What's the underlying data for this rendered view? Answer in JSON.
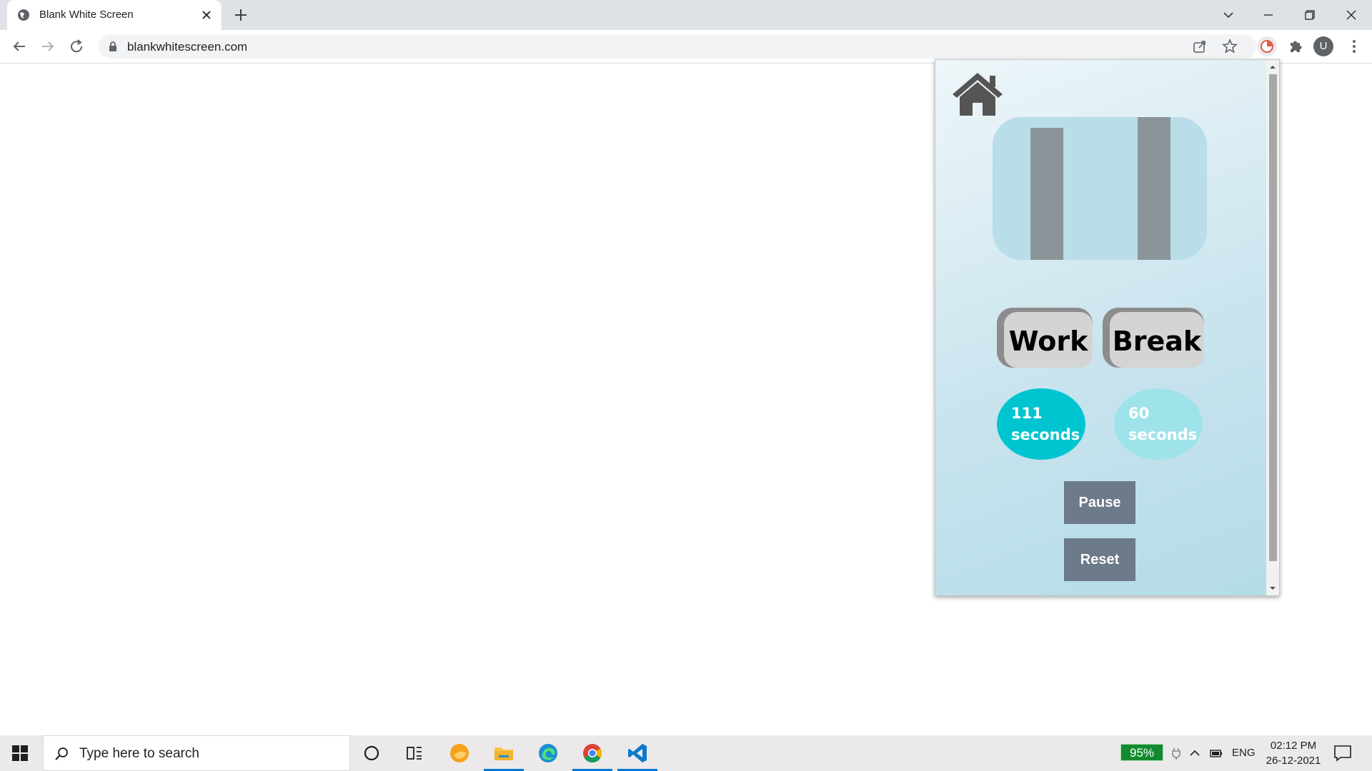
{
  "browser": {
    "tab_title": "Blank White Screen",
    "url": "blankwhitescreen.com",
    "profile_initial": "U"
  },
  "popup": {
    "mode_buttons": {
      "work": "Work",
      "break": "Break"
    },
    "durations": {
      "work": {
        "value": "111",
        "unit": "seconds",
        "color": "#00c5d1"
      },
      "break": {
        "value": "60",
        "unit": "seconds",
        "color": "#9fe3ea"
      }
    },
    "actions": {
      "pause": "Pause",
      "reset": "Reset"
    },
    "colors": {
      "display_bg": "#b9dde9",
      "button_bg": "#6c7a89"
    }
  },
  "taskbar": {
    "search_placeholder": "Type here to search",
    "battery": "95%",
    "language": "ENG",
    "time": "02:12 PM",
    "date": "26-12-2021"
  }
}
